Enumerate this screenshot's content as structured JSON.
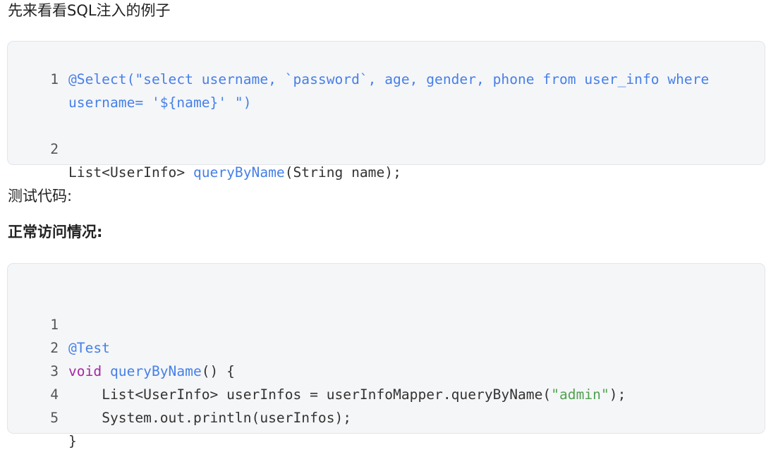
{
  "heading_1": "先来看看SQL注入的例子",
  "code_block_1": {
    "lines": [
      {
        "num": "1",
        "text": "@Select(\"select username, `password`, age, gender, phone from user_info where username= '${name}' \")"
      },
      {
        "num": "2",
        "type_text": "List<UserInfo> ",
        "method": "queryByName",
        "rest": "(String name);"
      }
    ]
  },
  "para_test_code": "测试代码:",
  "heading_normal": "正常访问情况:",
  "code_block_2": {
    "lines": [
      {
        "num": "1",
        "annotation": "@Test"
      },
      {
        "num": "2",
        "keyword": "void",
        "space": " ",
        "method": "queryByName",
        "rest": "() {"
      },
      {
        "num": "3",
        "prefix": "    List<UserInfo> userInfos = userInfoMapper.queryByName(",
        "string": "\"admin\"",
        "suffix": ");"
      },
      {
        "num": "4",
        "text": "    System.out.println(userInfos);"
      },
      {
        "num": "5",
        "text": "}"
      }
    ]
  },
  "colors": {
    "code_bg": "#f5f6f8",
    "blue": "#4680e8",
    "purple": "#a626a4",
    "green": "#50a14f"
  }
}
